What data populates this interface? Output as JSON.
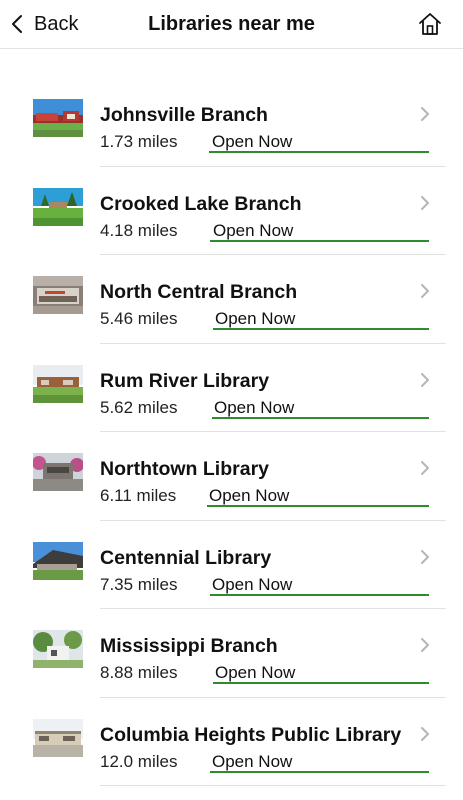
{
  "nav": {
    "back_label": "Back",
    "title": "Libraries near me",
    "back_icon": "chevron-left-icon",
    "home_icon": "home-icon"
  },
  "colors": {
    "accent_green": "#2e8b2e",
    "separator": "#e2e2e2"
  },
  "libraries": [
    {
      "name": "Johnsville Branch",
      "distance": "1.73 miles",
      "status": "Open Now"
    },
    {
      "name": "Crooked Lake Branch",
      "distance": "4.18 miles",
      "status": "Open Now"
    },
    {
      "name": "North Central Branch",
      "distance": "5.46 miles",
      "status": "Open Now"
    },
    {
      "name": "Rum River Library",
      "distance": "5.62 miles",
      "status": "Open Now"
    },
    {
      "name": "Northtown Library",
      "distance": "6.11 miles",
      "status": "Open Now"
    },
    {
      "name": "Centennial Library",
      "distance": "7.35 miles",
      "status": "Open Now"
    },
    {
      "name": "Mississippi Branch",
      "distance": "8.88 miles",
      "status": "Open Now"
    },
    {
      "name": "Columbia Heights Public Library",
      "distance": "12.0 miles",
      "status": "Open Now"
    }
  ]
}
